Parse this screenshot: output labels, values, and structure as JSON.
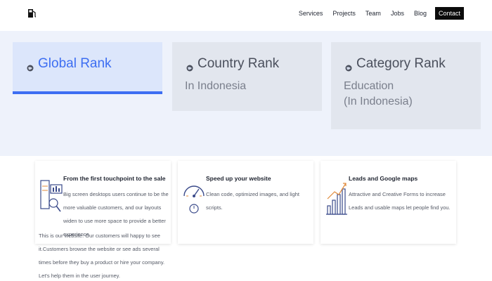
{
  "nav": {
    "items": [
      "Services",
      "Projects",
      "Team",
      "Jobs",
      "Blog"
    ],
    "contact": "Contact"
  },
  "ranks": [
    {
      "title": "Global Rank",
      "sub": "",
      "active": true
    },
    {
      "title": "Country Rank",
      "sub": "In Indonesia",
      "active": false
    },
    {
      "title": "Category Rank",
      "sub": "Education",
      "sub2": "(In Indonesia)",
      "active": false
    }
  ],
  "features": [
    {
      "title": "From the first touchpoint to the sale",
      "text": "Big screen desktops users continue to be the more valuable customers, and our layouts widen to use more space to provide a better experience",
      "text_cont": "This is our website. Our customers will happy to see it.Customers browse the website or see ads several times before they buy a product or hire your company. Let's help them in the user journey.",
      "icon": "analytics-icon"
    },
    {
      "title": "Speed up your website",
      "text": "Clean code, optimized images, and light scripts.",
      "icon": "speedometer-icon"
    },
    {
      "title": "Leads and Google maps",
      "text": "Attractive and Creative Forms to increase Leads and usable maps let people find you.",
      "icon": "growth-chart-icon"
    }
  ],
  "colors": {
    "accent": "#3d6ef2",
    "band": "#eef2fb",
    "card": "#e2e6ee",
    "card_active": "#dce6fb"
  }
}
